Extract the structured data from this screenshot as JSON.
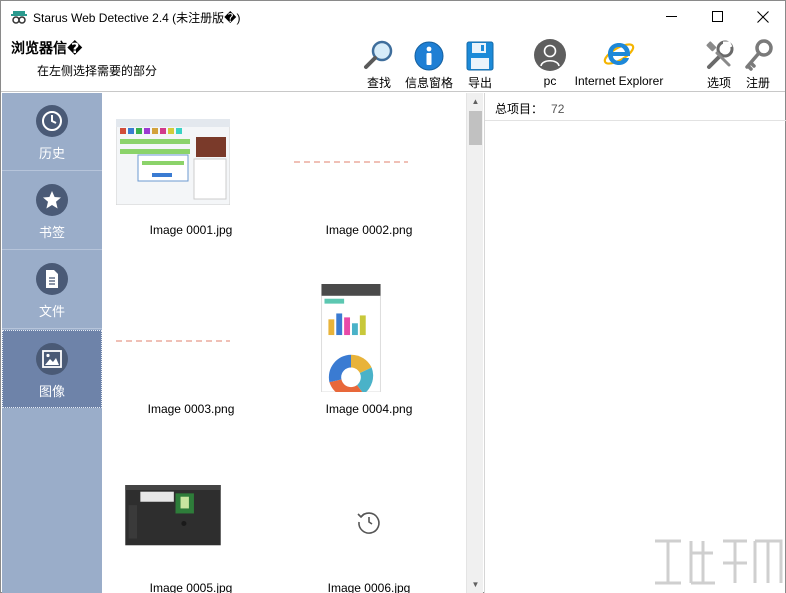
{
  "app": {
    "title": "Starus Web Detective 2.4 (未注册版�)"
  },
  "toolbar": {
    "heading": "浏览器信�",
    "subheading": "在左侧选择需要的部分",
    "find_label": "查找",
    "info_pane_label": "信息窗格",
    "export_label": "导出",
    "user_label": "pc",
    "browser_label": "Internet Explorer",
    "options_label": "选项",
    "register_label": "注册"
  },
  "sidebar": {
    "items": [
      {
        "label": "历史",
        "icon": "clock-icon"
      },
      {
        "label": "书签",
        "icon": "star-icon"
      },
      {
        "label": "文件",
        "icon": "document-icon"
      },
      {
        "label": "图像",
        "icon": "image-icon",
        "active": true
      }
    ]
  },
  "gallery": {
    "items": [
      {
        "label": "Image 0001.jpg"
      },
      {
        "label": "Image 0002.png"
      },
      {
        "label": "Image 0003.png"
      },
      {
        "label": "Image 0004.png"
      },
      {
        "label": "Image 0005.jpg"
      },
      {
        "label": "Image 0006.jpg"
      }
    ]
  },
  "details": {
    "total_label": "总项目：",
    "total_count": "72"
  },
  "colors": {
    "sidebar_bg": "#9aadc9",
    "sidebar_active": "#6e83a9",
    "nav_circle": "#4a5a76",
    "ie_blue": "#1e88d8"
  }
}
